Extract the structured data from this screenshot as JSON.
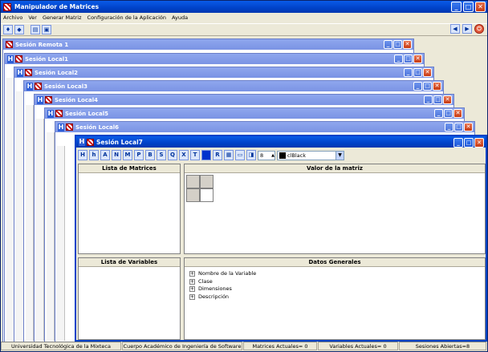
{
  "app": {
    "title": "Manipulador de Matrices",
    "menu": [
      "Archivo",
      "Ver",
      "Generar Matriz",
      "Configuración de la Aplicación",
      "Ayuda"
    ]
  },
  "window_buttons": {
    "minimize": "_",
    "maximize": "□",
    "close": "✕"
  },
  "child_windows": [
    "Sesión Remota  1",
    "Sesión Local1",
    "Sesión Local2",
    "Sesión Local3",
    "Sesión Local4",
    "Sesión Local5",
    "Sesión Local6"
  ],
  "active_window": {
    "title": "Sesión Local7",
    "toolbar_glyphs": [
      "H",
      "h",
      "A",
      "N",
      "M",
      "P",
      "B",
      "S",
      "Q",
      "X",
      "T",
      "■",
      "R",
      "▦",
      "▭",
      "◨"
    ],
    "spin_value": "8",
    "color_value": "clBlack",
    "panels": {
      "matrices_header": "Lista de Matrices",
      "value_header": "Valor de la matriz",
      "variables_header": "Lista de Variables",
      "general_header": "Datos Generales"
    },
    "general_tree": [
      "Nombre de la Variable",
      "Clase",
      "Dimensiones",
      "Descripción"
    ]
  },
  "status": {
    "university": "Universidad Tecnológica de la Mixteca",
    "group": "Cuerpo Académico de Ingeniería de Software",
    "matrices": "Matrices Actuales= 0",
    "variables": "Variables Actuales= 0",
    "sessions": "Sesiones Abiertas=8"
  },
  "colors": {
    "title_active": "#0042c8",
    "title_inactive": "#7a93e4",
    "close": "#c63a14"
  }
}
